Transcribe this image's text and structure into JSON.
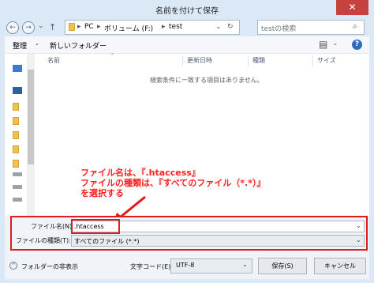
{
  "window": {
    "title": "名前を付けて保存",
    "close_glyph": "✕"
  },
  "nav": {
    "back_glyph": "←",
    "forward_glyph": "→",
    "history_glyph": "⌄",
    "up_glyph": "↑",
    "breadcrumb": [
      "PC",
      "ボリューム (F:)",
      "test"
    ],
    "separator": "▸",
    "dropdown_glyph": "⌄",
    "refresh_glyph": "↻",
    "search_placeholder": "testの検索",
    "search_glyph": "⌕"
  },
  "toolbar": {
    "organize_label": "整理",
    "new_folder_label": "新しいフォルダー",
    "view_glyph": "▤",
    "help_glyph": "?"
  },
  "columns": [
    "名前",
    "更新日時",
    "種類",
    "サイズ"
  ],
  "empty_message": "検索条件に一致する項目はありません。",
  "annotation": {
    "line1": "ファイル名は、『.htaccess』",
    "line2": "ファイルの種類は、『すべてのファイル（*.*）』",
    "line3": "を選択する"
  },
  "form": {
    "filename_label": "ファイル名(N):",
    "filename_value": ".htaccess",
    "filetype_label": "ファイルの種類(T):",
    "filetype_value": "すべてのファイル (*.*)"
  },
  "footer": {
    "hide_folders": "フォルダーの非表示",
    "encoding_label": "文字コード(E):",
    "encoding_value": "UTF-8",
    "save_label": "保存(S)",
    "cancel_label": "キャンセル"
  },
  "colors": {
    "accent": "#ff1f1f",
    "titlebar": "#dbe9f7",
    "close": "#c7413f"
  }
}
